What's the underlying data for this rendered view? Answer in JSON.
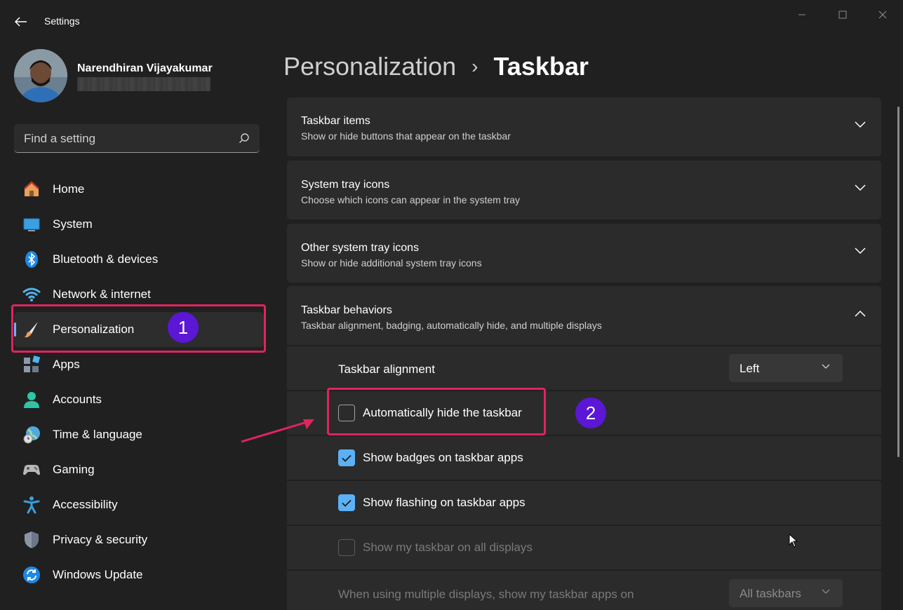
{
  "window": {
    "title": "Settings",
    "controls": {
      "minimize": "minimize-icon",
      "maximize": "maximize-icon",
      "close": "close-icon"
    }
  },
  "profile": {
    "name": "Narendhiran Vijayakumar"
  },
  "search": {
    "placeholder": "Find a setting"
  },
  "sidebar": {
    "items": [
      {
        "label": "Home",
        "icon": "home-icon"
      },
      {
        "label": "System",
        "icon": "monitor-icon"
      },
      {
        "label": "Bluetooth & devices",
        "icon": "bluetooth-icon"
      },
      {
        "label": "Network & internet",
        "icon": "wifi-icon"
      },
      {
        "label": "Personalization",
        "icon": "brush-icon",
        "active": true
      },
      {
        "label": "Apps",
        "icon": "apps-icon"
      },
      {
        "label": "Accounts",
        "icon": "account-icon"
      },
      {
        "label": "Time & language",
        "icon": "globe-clock-icon"
      },
      {
        "label": "Gaming",
        "icon": "gamepad-icon"
      },
      {
        "label": "Accessibility",
        "icon": "accessibility-icon"
      },
      {
        "label": "Privacy & security",
        "icon": "shield-icon"
      },
      {
        "label": "Windows Update",
        "icon": "update-icon"
      }
    ]
  },
  "breadcrumb": {
    "parent": "Personalization",
    "separator": "›",
    "current": "Taskbar"
  },
  "sections": [
    {
      "title": "Taskbar items",
      "description": "Show or hide buttons that appear on the taskbar",
      "expanded": false
    },
    {
      "title": "System tray icons",
      "description": "Choose which icons can appear in the system tray",
      "expanded": false
    },
    {
      "title": "Other system tray icons",
      "description": "Show or hide additional system tray icons",
      "expanded": false
    },
    {
      "title": "Taskbar behaviors",
      "description": "Taskbar alignment, badging, automatically hide, and multiple displays",
      "expanded": true
    }
  ],
  "behaviors": {
    "alignment": {
      "label": "Taskbar alignment",
      "value": "Left"
    },
    "options": [
      {
        "label": "Automatically hide the taskbar",
        "checked": false,
        "enabled": true
      },
      {
        "label": "Show badges on taskbar apps",
        "checked": true,
        "enabled": true
      },
      {
        "label": "Show flashing on taskbar apps",
        "checked": true,
        "enabled": true
      },
      {
        "label": "Show my taskbar on all displays",
        "checked": false,
        "enabled": false
      }
    ],
    "multi_display": {
      "label": "When using multiple displays, show my taskbar apps on",
      "value": "All taskbars",
      "enabled": false
    }
  },
  "annotations": {
    "badge_1": "1",
    "badge_2": "2",
    "color": "#e0245e",
    "badge_color": "#5b16d6"
  },
  "colors": {
    "background": "#202020",
    "card": "#2b2b2b",
    "accent": "#5cb0f5"
  }
}
